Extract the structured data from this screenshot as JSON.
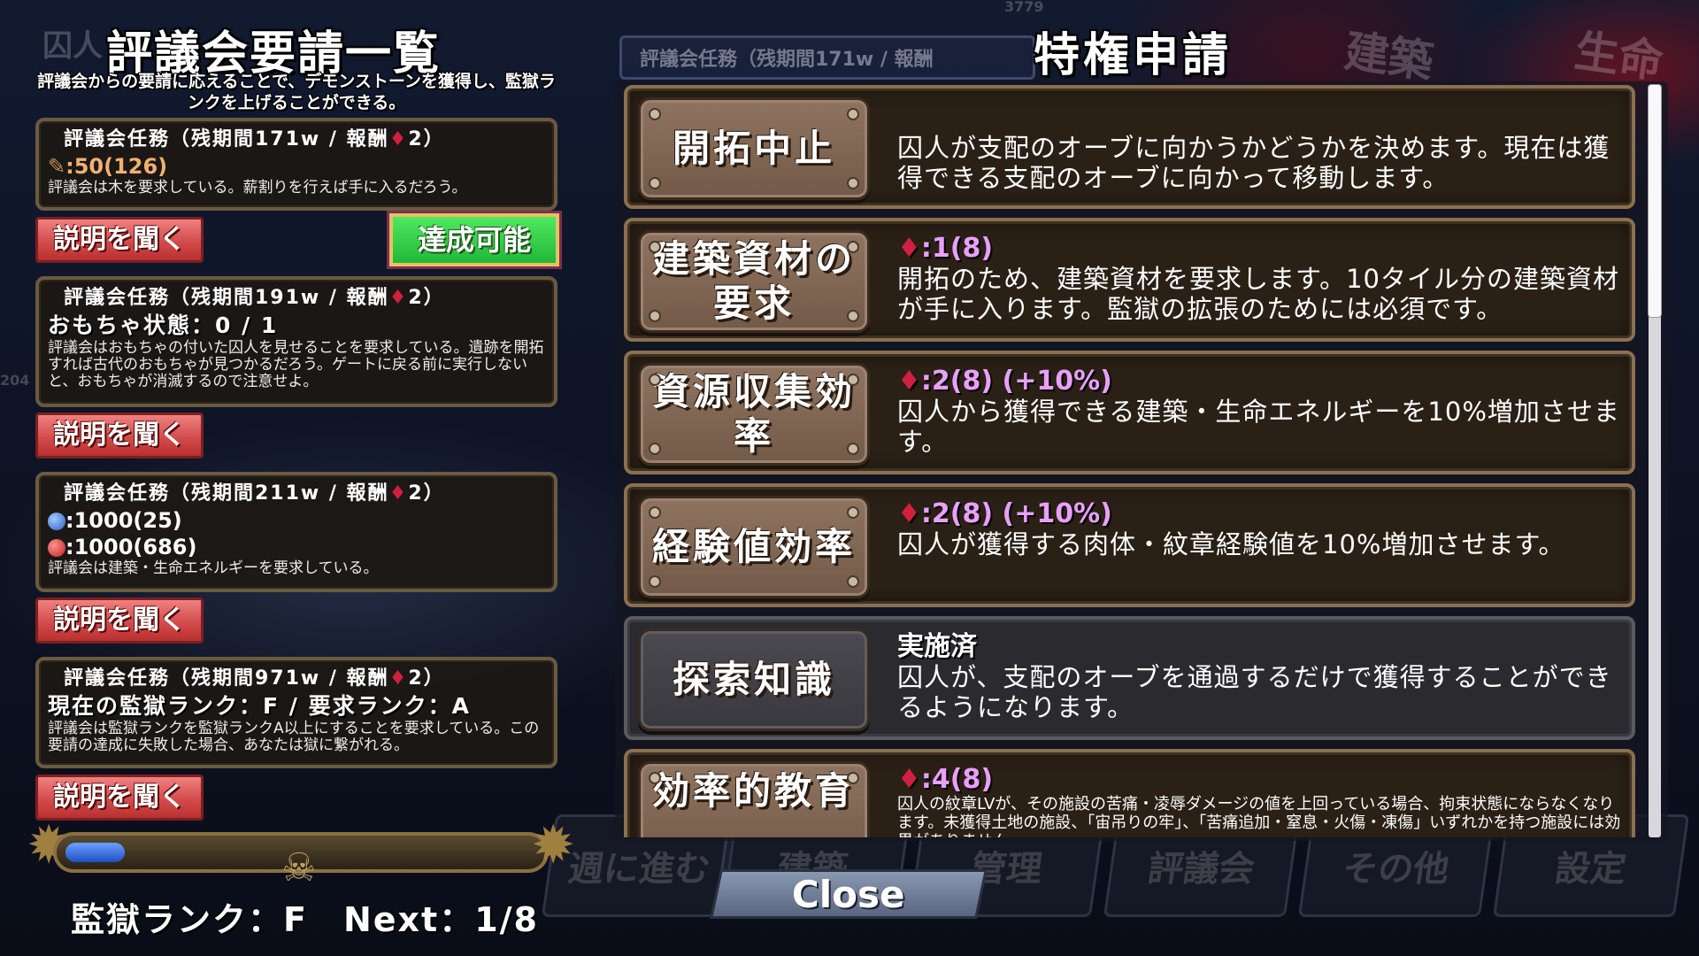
{
  "background": {
    "top_number": "3779",
    "left_number": "204",
    "tabs": [
      "建築",
      "生命"
    ],
    "menu": [
      "週に進む",
      "建築",
      "管理",
      "評議会",
      "その他",
      "設定"
    ],
    "ghost_task": "評議会任務（残期間171w / 報酬",
    "left_title_fragment": "囚人"
  },
  "council": {
    "title": "評議会要請一覧",
    "description": "評議会からの要請に応えることで、デモンストーンを獲得し、監獄ランクを上げることができる。",
    "explain_label": "説明を聞く",
    "achieve_label": "達成可能",
    "tasks": [
      {
        "head": "評議会任務（残期間171w / 報酬",
        "reward": "2）",
        "line1": ":50(126)",
        "note": "評議会は木を要求している。薪割りを行えば手に入るだろう。"
      },
      {
        "head": "評議会任務（残期間191w / 報酬",
        "reward": "2）",
        "line1": "おもちゃ状態：0 / 1",
        "note": "評議会はおもちゃの付いた囚人を見せることを要求している。遺跡を開拓すれば古代のおもちゃが見つかるだろう。ゲートに戻る前に実行しないと、おもちゃが消滅するので注意せよ。"
      },
      {
        "head": "評議会任務（残期間211w / 報酬",
        "reward": "2）",
        "line1": ":1000(25)",
        "line2": ":1000(686)",
        "note": "評議会は建築・生命エネルギーを要求している。"
      },
      {
        "head": "評議会任務（残期間971w / 報酬",
        "reward": "2）",
        "line1": "現在の監獄ランク：F / 要求ランク：A",
        "note": "評議会は監獄ランクを監獄ランクA以上にすることを要求している。この要請の達成に失敗した場合、あなたは獄に繋がれる。"
      }
    ],
    "rank_progress": 0.125,
    "rank_text": "監獄ランク：F　Next：1/8"
  },
  "privileges": {
    "title": "特権申請",
    "items": [
      {
        "name": "開拓中止",
        "cost": "",
        "status": "",
        "desc": "囚人が支配のオーブに向かうかどうかを決めます。現在は獲得できる支配のオーブに向かって移動します。"
      },
      {
        "name": "建築資材の要求",
        "cost": ":1(8)",
        "status": "",
        "desc": "開拓のため、建築資材を要求します。10タイル分の建築資材が手に入ります。監獄の拡張のためには必須です。"
      },
      {
        "name": "資源収集効率",
        "cost": ":2(8) (+10%)",
        "status": "",
        "desc": "囚人から獲得できる建築・生命エネルギーを10%増加させます。"
      },
      {
        "name": "経験値効率",
        "cost": ":2(8) (+10%)",
        "status": "",
        "desc": "囚人が獲得する肉体・紋章経験値を10%増加させます。"
      },
      {
        "name": "探索知識",
        "cost": "",
        "status": "実施済",
        "desc": "囚人が、支配のオーブを通過するだけで獲得することができるようになります。"
      },
      {
        "name": "効率的教育",
        "cost": ":4(8)",
        "status": "",
        "desc": "囚人の紋章LVが、その施設の苦痛・凌辱ダメージの値を上回っている場合、拘束状態にならなくなります。未獲得土地の施設、「宙吊りの牢」、「苦痛追加・窒息・火傷・凍傷」いずれかを持つ施設には効果がありません。"
      }
    ]
  },
  "close_label": "Close",
  "colors": {
    "accent_gem": "#d02040",
    "achieve_green": "#30c848",
    "explain_red": "#d04848",
    "cost_pink": "#e8a0f8",
    "rank_blue": "#3a70e0"
  }
}
